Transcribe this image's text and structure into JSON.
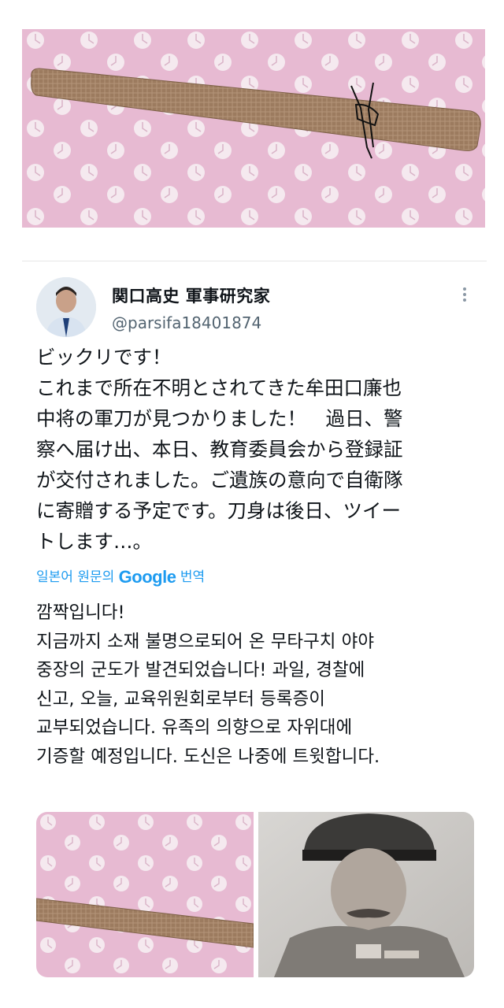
{
  "tweet": {
    "author": {
      "display_name": "関口高史 軍事研究家",
      "handle": "@parsifa18401874"
    },
    "text_ja": "ビックリです！\nこれまで所在不明とされてきた牟田口廉也\n中将の軍刀が見つかりました！　過日、警\n察へ届け出、本日、教育委員会から登録証\nが交付されました。ご遺族の意向で自衛隊\nに寄贈する予定です。刀身は後日、ツイー\nトします…。",
    "translation": {
      "prefix": "일본어 원문의",
      "brand": "Google",
      "suffix": "번역"
    },
    "text_ko": "깜짝입니다!\n지금까지 소재 불명으로되어 온 무타구치 야야\n중장의 군도가 발견되었습니다! 과일, 경찰에\n신고, 오늘, 교육위원회로부터 등록증이\n교부되었습니다. 유족의 의향으로 자위대에\n기증할 예정입니다. 도신은 나중에 트윗합니다."
  },
  "colors": {
    "link": "#1d9bf0",
    "text": "#0f1419",
    "muted": "#536471",
    "cloth": "#e8bcd3",
    "scabbard": "#9a7a5e"
  }
}
